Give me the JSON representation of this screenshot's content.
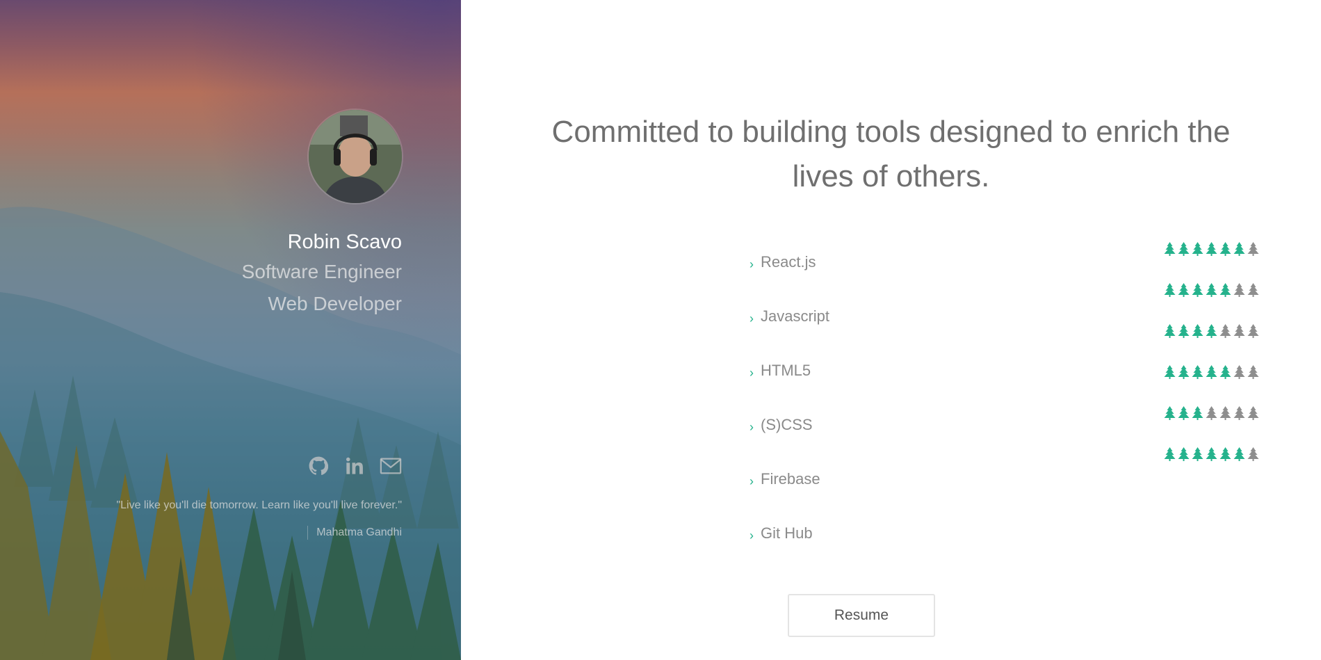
{
  "profile": {
    "name": "Robin Scavo",
    "roles": [
      "Software Engineer",
      "Web Developer"
    ]
  },
  "social": {
    "icons": [
      "github-icon",
      "linkedin-icon",
      "mail-icon"
    ]
  },
  "quote": {
    "text": "\"Live like you'll die tomorrow. Learn like you'll live forever.\"",
    "author": "Mahatma Gandhi"
  },
  "headline": "Committed to building tools designed to enrich the lives of others.",
  "skills": [
    {
      "label": "React.js"
    },
    {
      "label": "Javascript"
    },
    {
      "label": "HTML5"
    },
    {
      "label": "(S)CSS"
    },
    {
      "label": "Firebase"
    },
    {
      "label": "Git Hub"
    }
  ],
  "ratings": [
    6,
    5,
    4,
    5,
    3,
    6
  ],
  "rating_max": 7,
  "resume": {
    "label": "Resume"
  },
  "colors": {
    "accent": "#25b28c",
    "tree_inactive": "#8e8e8e",
    "headline": "#6f6f6f"
  }
}
